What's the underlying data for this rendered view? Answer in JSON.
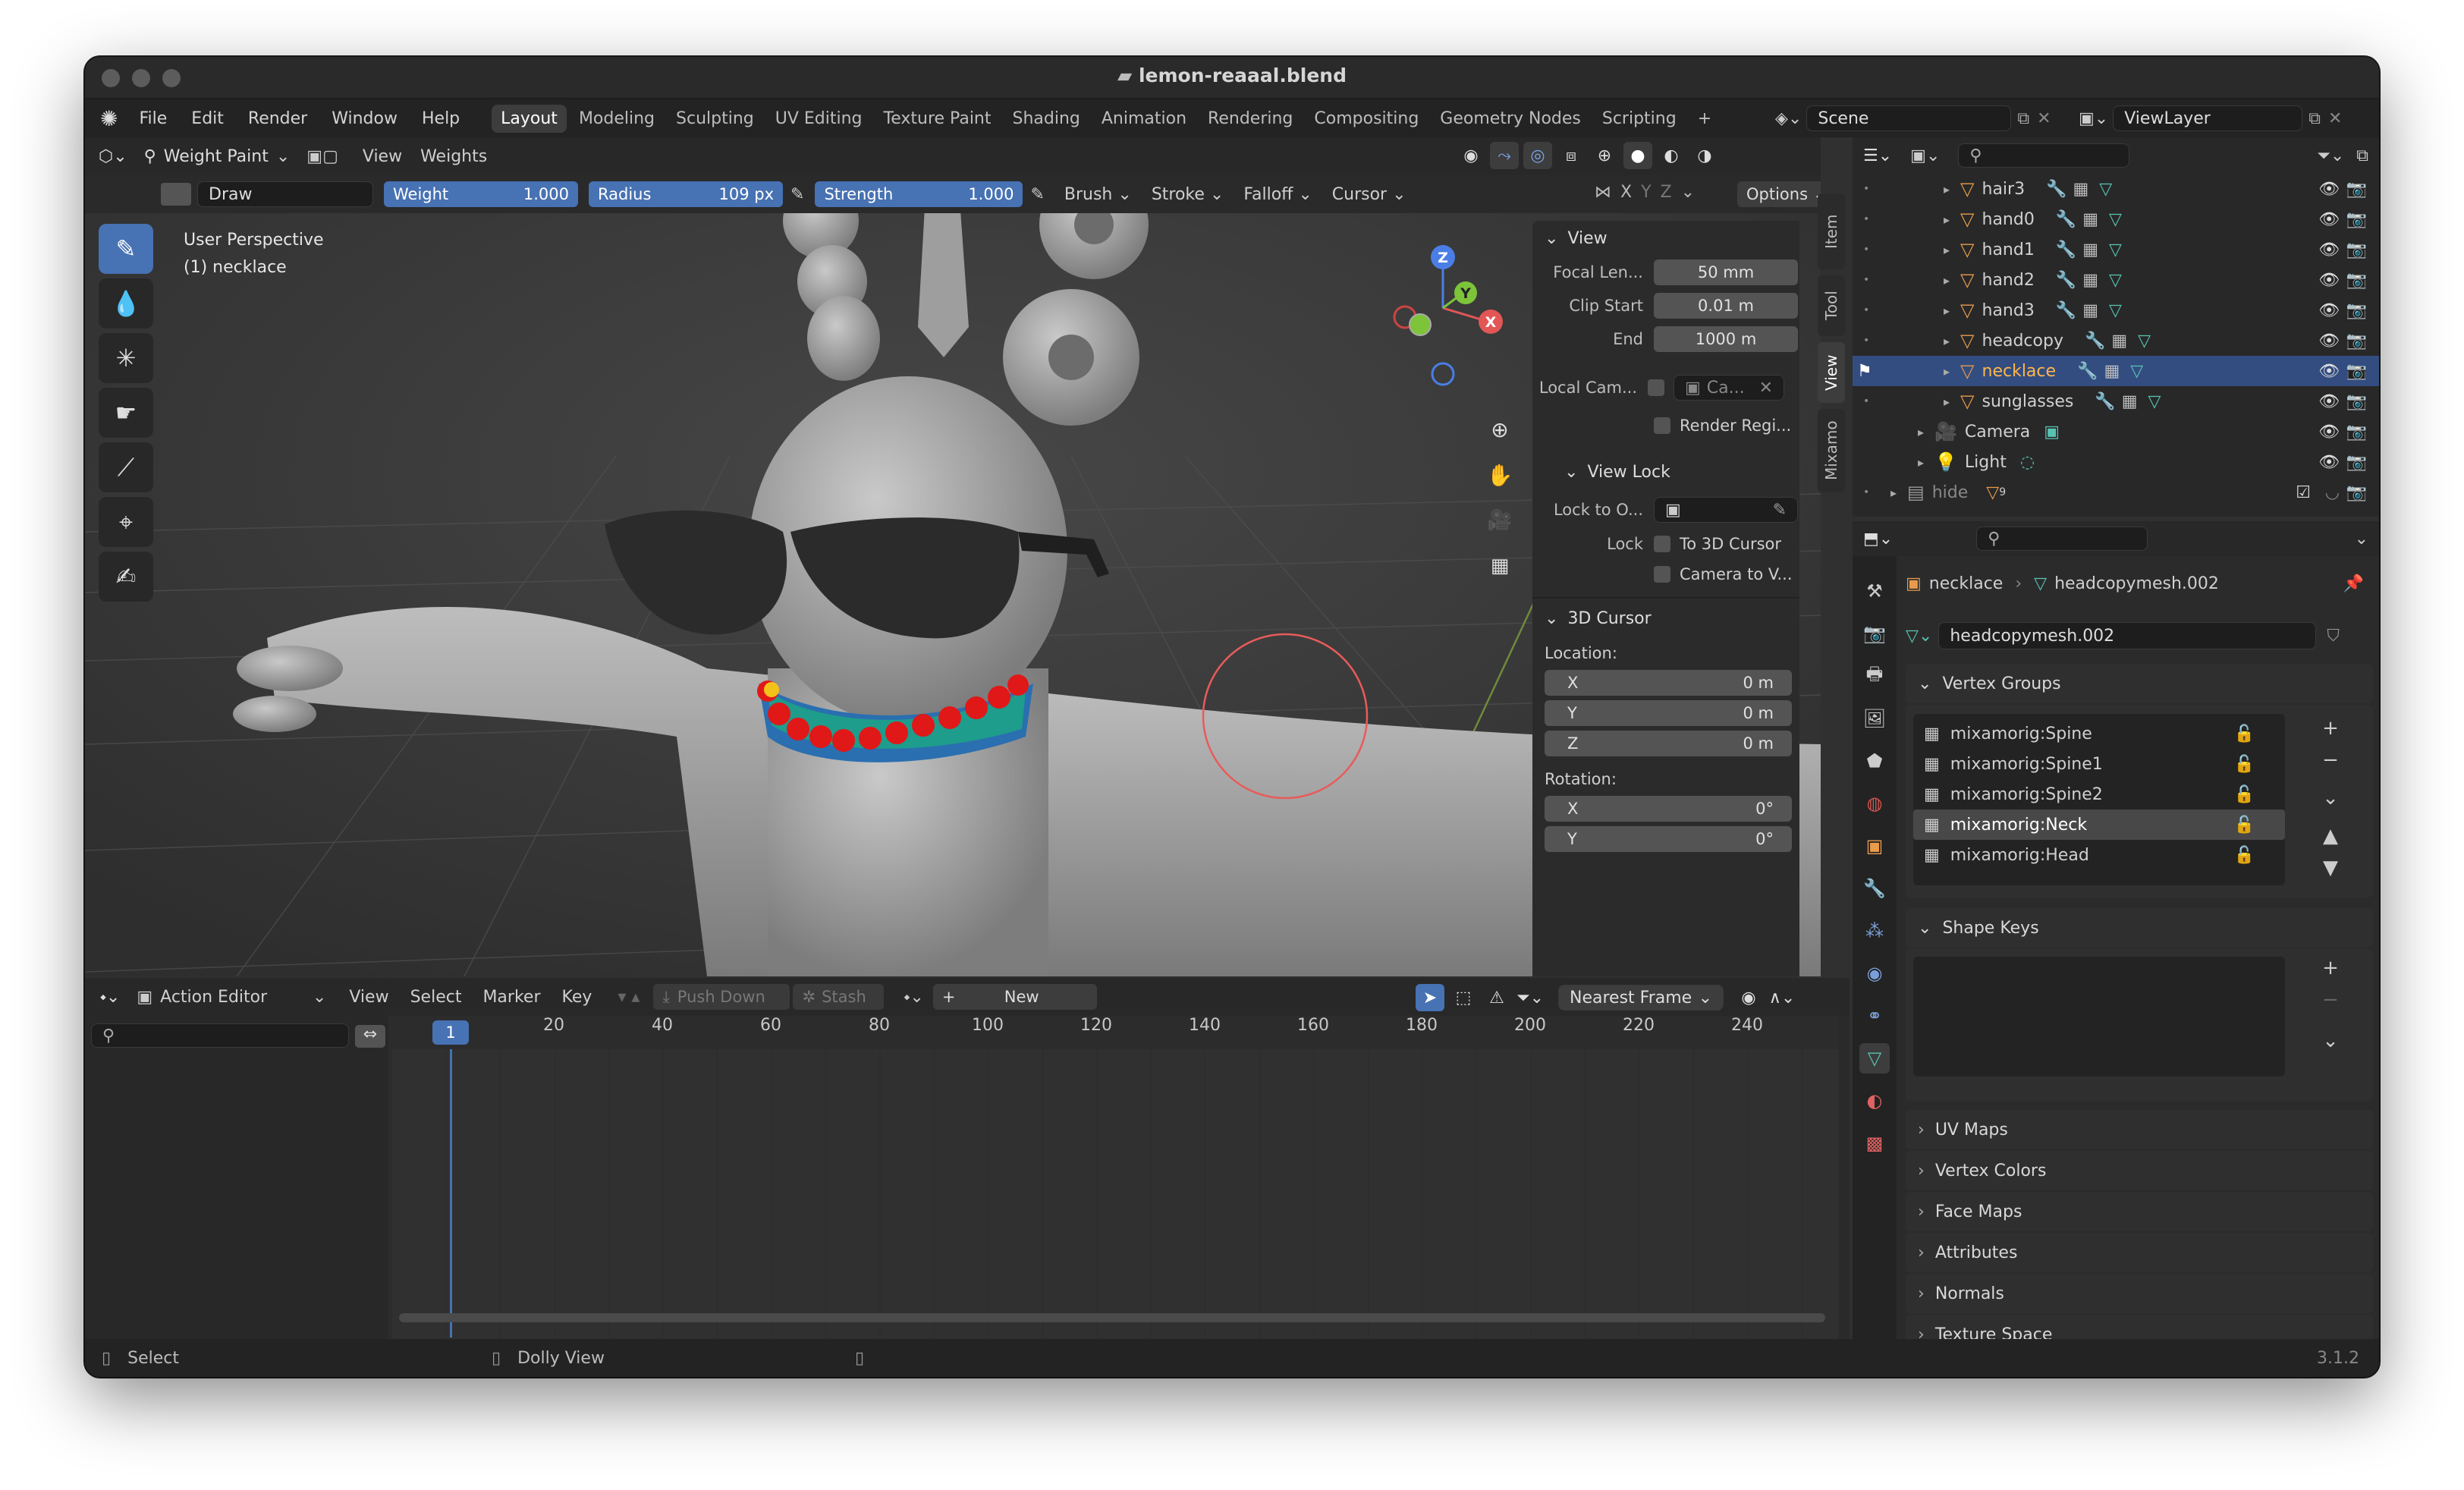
{
  "window": {
    "title": "lemon-reaaal.blend"
  },
  "topbar": {
    "menus": [
      "File",
      "Edit",
      "Render",
      "Window",
      "Help"
    ],
    "workspaces": [
      "Layout",
      "Modeling",
      "Sculpting",
      "UV Editing",
      "Texture Paint",
      "Shading",
      "Animation",
      "Rendering",
      "Compositing",
      "Geometry Nodes",
      "Scripting"
    ],
    "active_workspace": "Layout",
    "add_tab": "+",
    "scene": "Scene",
    "view_layer": "ViewLayer"
  },
  "viewport": {
    "mode": "Weight Paint",
    "menus": [
      "View",
      "Weights"
    ],
    "brush_name": "Draw",
    "weight_label": "Weight",
    "weight_value": "1.000",
    "radius_label": "Radius",
    "radius_value": "109 px",
    "strength_label": "Strength",
    "strength_value": "1.000",
    "dropdowns": [
      "Brush",
      "Stroke",
      "Falloff",
      "Cursor"
    ],
    "axes": [
      "X",
      "Y",
      "Z"
    ],
    "options_label": "Options",
    "overlay_line1": "User Perspective",
    "overlay_line2": "(1) necklace",
    "gizmo": {
      "z": "Z",
      "y": "Y",
      "x": "X"
    }
  },
  "npanel": {
    "tabs": [
      "Item",
      "Tool",
      "View",
      "Mixamo"
    ],
    "active_tab": "View",
    "view_header": "View",
    "focal_label": "Focal Len...",
    "focal_value": "50 mm",
    "clip_start_label": "Clip Start",
    "clip_start_value": "0.01 m",
    "end_label": "End",
    "end_value": "1000 m",
    "local_cam_label": "Local Cam...",
    "local_cam_value": "Ca...",
    "render_region": "Render Regi...",
    "view_lock_header": "View Lock",
    "lock_to_label": "Lock to O...",
    "lock_label": "Lock",
    "to_3d_cursor": "To 3D Cursor",
    "camera_to_view": "Camera to V...",
    "cursor_header": "3D Cursor",
    "location_label": "Location:",
    "loc": [
      {
        "axis": "X",
        "value": "0 m"
      },
      {
        "axis": "Y",
        "value": "0 m"
      },
      {
        "axis": "Z",
        "value": "0 m"
      }
    ],
    "rotation_label": "Rotation:",
    "rot": [
      {
        "axis": "X",
        "value": "0°"
      },
      {
        "axis": "Y",
        "value": "0°"
      }
    ]
  },
  "action_editor": {
    "editor": "Action Editor",
    "menus": [
      "View",
      "Select",
      "Marker",
      "Key"
    ],
    "push_down": "Push Down",
    "stash": "Stash",
    "new_label": "New",
    "snap": "Nearest Frame",
    "current_frame": "1",
    "frame_ticks": [
      "20",
      "40",
      "60",
      "80",
      "100",
      "120",
      "140",
      "160",
      "180",
      "200",
      "220",
      "240"
    ]
  },
  "outliner": {
    "items": [
      {
        "name": "hair3",
        "type": "mesh",
        "selected": false
      },
      {
        "name": "hand0",
        "type": "mesh",
        "selected": false
      },
      {
        "name": "hand1",
        "type": "mesh",
        "selected": false
      },
      {
        "name": "hand2",
        "type": "mesh",
        "selected": false
      },
      {
        "name": "hand3",
        "type": "mesh",
        "selected": false
      },
      {
        "name": "headcopy",
        "type": "mesh",
        "selected": false
      },
      {
        "name": "necklace",
        "type": "mesh",
        "selected": true
      },
      {
        "name": "sunglasses",
        "type": "mesh",
        "selected": false
      },
      {
        "name": "Camera",
        "type": "camera",
        "selected": false
      },
      {
        "name": "Light",
        "type": "light",
        "selected": false
      },
      {
        "name": "hide",
        "type": "collection",
        "selected": false
      }
    ],
    "hide_count": "9"
  },
  "properties": {
    "breadcrumb_object": "necklace",
    "breadcrumb_data": "headcopymesh.002",
    "mesh_name": "headcopymesh.002",
    "vertex_groups_header": "Vertex Groups",
    "vertex_groups": [
      {
        "name": "mixamorig:Spine",
        "selected": false
      },
      {
        "name": "mixamorig:Spine1",
        "selected": false
      },
      {
        "name": "mixamorig:Spine2",
        "selected": false
      },
      {
        "name": "mixamorig:Neck",
        "selected": true
      },
      {
        "name": "mixamorig:Head",
        "selected": false
      }
    ],
    "shape_keys_header": "Shape Keys",
    "sections": [
      "UV Maps",
      "Vertex Colors",
      "Face Maps",
      "Attributes",
      "Normals",
      "Texture Space"
    ]
  },
  "statusbar": {
    "select": "Select",
    "dolly": "Dolly View",
    "version": "3.1.2"
  },
  "colors": {
    "accent": "#4772b3",
    "selected_row": "#334d80",
    "mesh_icon": "#e89b4b",
    "data_icon": "#57c4b3"
  }
}
